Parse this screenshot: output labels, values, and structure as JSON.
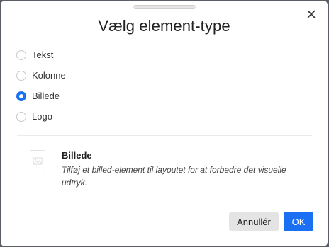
{
  "dialog": {
    "title": "Vælg element-type",
    "close_icon": "close-icon",
    "options": [
      {
        "label": "Tekst",
        "selected": false
      },
      {
        "label": "Kolonne",
        "selected": false
      },
      {
        "label": "Billede",
        "selected": true
      },
      {
        "label": "Logo",
        "selected": false
      }
    ],
    "description": {
      "icon": "image-document-icon",
      "title": "Billede",
      "text": "Tilføj et billed-element til layoutet for at forbedre det visuelle udtryk."
    },
    "buttons": {
      "cancel_label": "Annullér",
      "ok_label": "OK"
    }
  },
  "colors": {
    "accent": "#1a6ff2",
    "cancel_bg": "#e4e4e4",
    "backdrop": "#5a5f66"
  }
}
